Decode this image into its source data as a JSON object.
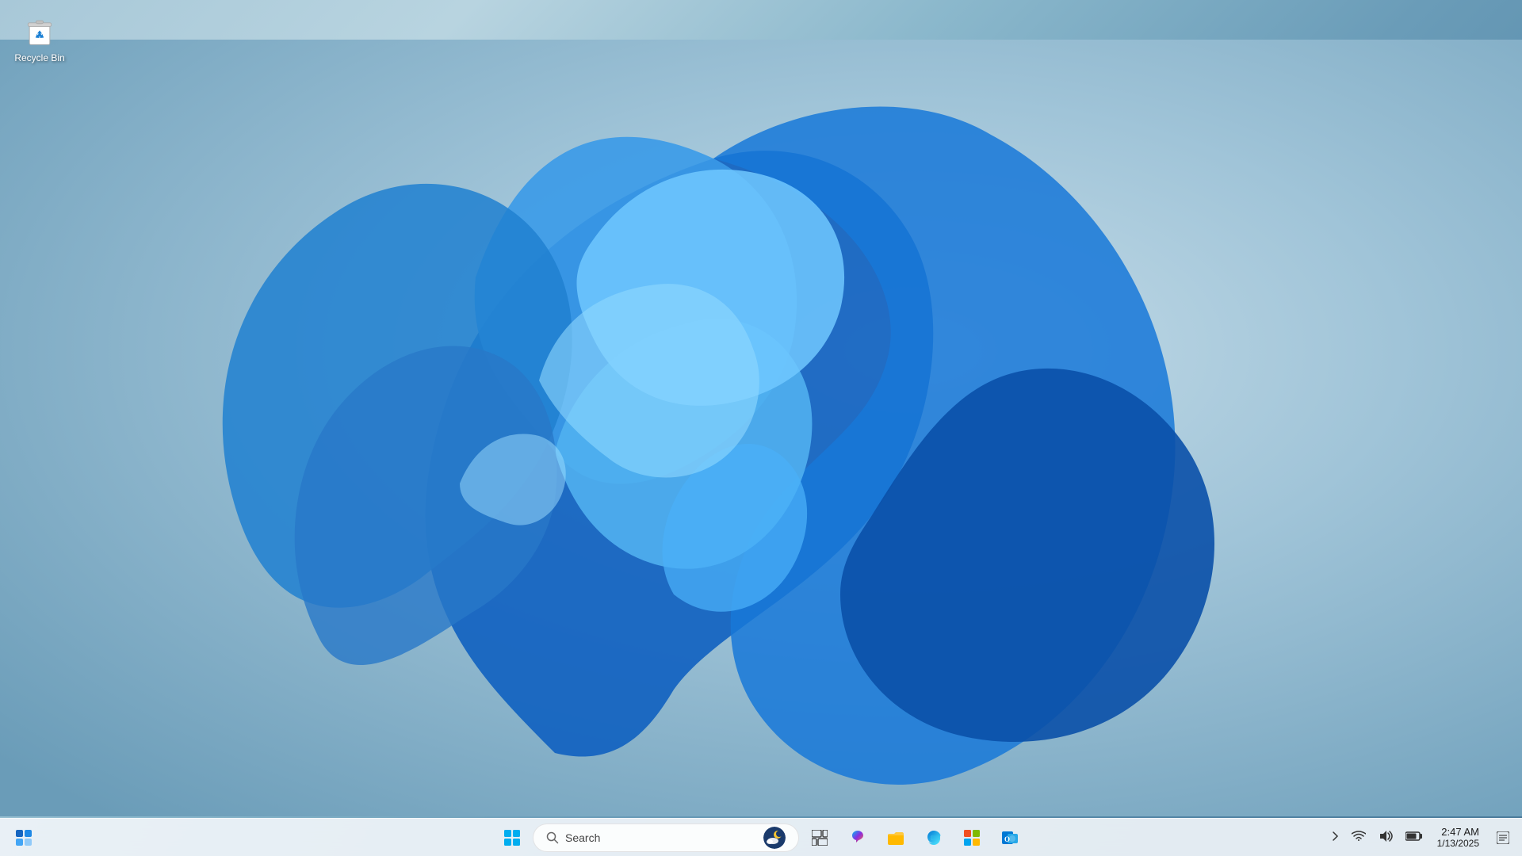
{
  "desktop": {
    "background_color_start": "#a8c8d8",
    "background_color_end": "#4a7a9a"
  },
  "recycle_bin": {
    "label": "Recycle Bin",
    "icon": "recycle-bin-icon"
  },
  "taskbar": {
    "start_button_label": "Start",
    "search_placeholder": "Search",
    "search_label": "Search",
    "apps": [
      {
        "name": "widgets",
        "label": "Widgets",
        "icon": "widgets-icon"
      },
      {
        "name": "start",
        "label": "Start",
        "icon": "start-icon"
      },
      {
        "name": "search",
        "label": "Search",
        "icon": "search-icon"
      },
      {
        "name": "task-view",
        "label": "Task View",
        "icon": "task-view-icon"
      },
      {
        "name": "copilot",
        "label": "Copilot",
        "icon": "copilot-icon"
      },
      {
        "name": "file-explorer",
        "label": "File Explorer",
        "icon": "file-explorer-icon"
      },
      {
        "name": "edge",
        "label": "Microsoft Edge",
        "icon": "edge-icon"
      },
      {
        "name": "microsoft-store",
        "label": "Microsoft Store",
        "icon": "store-icon"
      },
      {
        "name": "outlook",
        "label": "Outlook",
        "icon": "outlook-icon"
      }
    ],
    "system_tray": {
      "chevron_label": "Show hidden icons",
      "wifi_label": "WiFi",
      "volume_label": "Volume",
      "battery_label": "Battery",
      "notification_label": "Notifications"
    },
    "clock": {
      "time": "2:47 AM",
      "date": "1/13/2025"
    }
  }
}
